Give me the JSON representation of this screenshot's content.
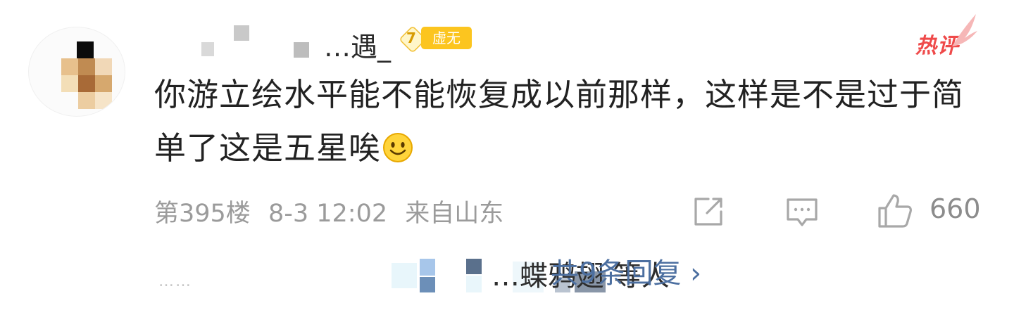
{
  "user": {
    "name_visible": "…遇_",
    "level": "7",
    "level_title": "虚无"
  },
  "hot_tag": "热评",
  "comment": {
    "text": "你游立绘水平能不能恢复成以前那样，这样是不是过于简单了这是五星唉"
  },
  "meta": {
    "floor": "第395楼",
    "time": "8-3 12:02",
    "location": "来自山东"
  },
  "actions": {
    "share_icon": "share-icon",
    "reply_icon": "comment-icon",
    "like_icon": "thumbs-up-icon",
    "like_count": "660"
  },
  "replies": {
    "dots": "……",
    "names_visible": "…蝶鸦翅 等人",
    "more": "共9条回复 ›"
  },
  "colors": {
    "text": "#222222",
    "meta": "#9b9b9b",
    "link": "#4c6fa0",
    "hot": "#ef4a4a",
    "badge": "#fcc51f"
  }
}
